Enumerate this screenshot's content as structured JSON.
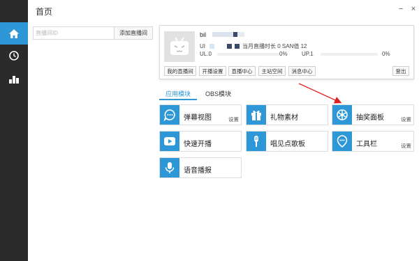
{
  "window": {
    "title": "首页",
    "minimize": "−",
    "close": "×"
  },
  "sidebar": {
    "items": [
      {
        "icon": "home-icon",
        "active": true
      },
      {
        "icon": "clock-icon",
        "active": false
      },
      {
        "icon": "bar-chart-icon",
        "active": false
      }
    ]
  },
  "search": {
    "placeholder": "直播间ID",
    "value": "",
    "add_label": "添加直播间"
  },
  "user": {
    "name": "bil",
    "uid_prefix": "UI",
    "month_info": "当月直播时长 0 SAN值 12",
    "ul_label": "UL.0",
    "ul_pct": "0%",
    "up_label": "UP.1",
    "up_pct": "0%",
    "buttons": [
      "我的直播间",
      "开播设置",
      "直播中心",
      "主站空间",
      "消息中心"
    ],
    "logout": "登出"
  },
  "tabs": [
    {
      "label": "应用模块",
      "active": true
    },
    {
      "label": "OBS模块",
      "active": false
    }
  ],
  "modules": [
    {
      "label": "弹幕视图",
      "icon": "chat-bubble-icon",
      "setting": "设置"
    },
    {
      "label": "礼物素材",
      "icon": "gift-icon",
      "setting": ""
    },
    {
      "label": "抽奖面板",
      "icon": "wheel-icon",
      "setting": "设置"
    },
    {
      "label": "快速开播",
      "icon": "play-icon",
      "setting": ""
    },
    {
      "label": "唱见点歌板",
      "icon": "mic-stand-icon",
      "setting": ""
    },
    {
      "label": "工具栏",
      "icon": "pin-icon",
      "setting": "设置"
    },
    {
      "label": "语音播报",
      "icon": "microphone-icon",
      "setting": ""
    }
  ],
  "colors": {
    "accent": "#2e97d8",
    "sidebar": "#2b2b2b",
    "arrow": "#e02020"
  }
}
